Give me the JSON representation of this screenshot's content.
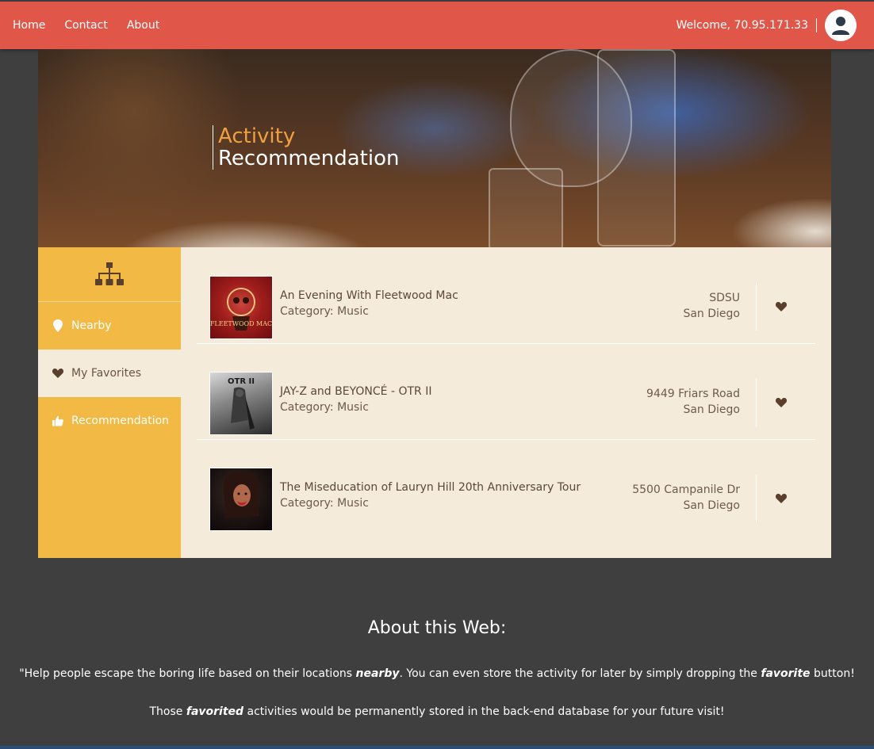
{
  "nav": {
    "links": [
      "Home",
      "Contact",
      "About"
    ],
    "welcome": "Welcome, 70.95.171.33"
  },
  "banner": {
    "title_line1": "Activity",
    "title_line2": "Recommendation"
  },
  "sidebar": {
    "icon": "sitemap-icon",
    "items": [
      {
        "label": "Nearby",
        "icon": "map-marker-icon"
      },
      {
        "label": "My Favorites",
        "icon": "heart-icon"
      },
      {
        "label": "Recommendation",
        "icon": "thumbs-up-icon"
      }
    ]
  },
  "events": [
    {
      "name": "An Evening With Fleetwood Mac",
      "category": "Category: Music",
      "address1": "SDSU",
      "address2": "San Diego"
    },
    {
      "name": "JAY-Z and BEYONCÉ - OTR II",
      "category": "Category: Music",
      "address1": "9449 Friars Road",
      "address2": "San Diego"
    },
    {
      "name": "The Miseducation of Lauryn Hill 20th Anniversary Tour",
      "category": "Category: Music",
      "address1": "5500 Campanile Dr",
      "address2": "San Diego"
    }
  ],
  "thumb_text": {
    "fleetwood": "FLEETWOOD MAC",
    "otr": "OTR II"
  },
  "about": {
    "title": "About this Web:",
    "p1_a": "\"Help people escape the boring life based on their locations ",
    "p1_b": "nearby",
    "p1_c": ". You can even store the activity for later by simply dropping the ",
    "p1_d": "favorite",
    "p1_e": " button!",
    "p2_a": "Those ",
    "p2_b": "favorited",
    "p2_c": " activities would be permanently stored in the back-end database for your future visit!"
  },
  "colors": {
    "nav": "#e0574a",
    "sidebar": "#f2b944",
    "content": "#f4ebda",
    "accent_orange": "#f0a040",
    "heart": "#5a3f2c"
  }
}
